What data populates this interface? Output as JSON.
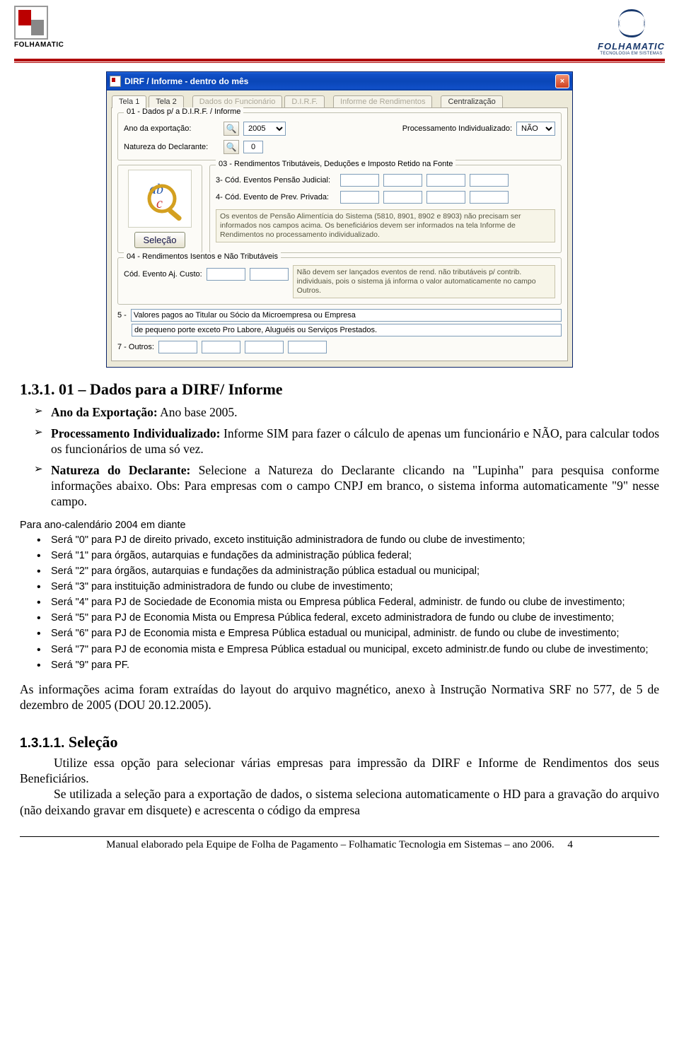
{
  "header": {
    "logo_left_label": "FOLHAMATIC",
    "logo_right_label": "FOLHAMATIC",
    "logo_right_sub": "TECNOLOGIA EM SISTEMAS"
  },
  "window": {
    "title": "DIRF / Informe - dentro do mês",
    "tabs": [
      "Tela 1",
      "Tela 2",
      "Dados do Funcionário",
      "D.I.R.F.",
      "Informe de Rendimentos",
      "Centralização"
    ],
    "section01": {
      "title": "01 - Dados p/ a D.I.R.F. / Informe",
      "ano_label": "Ano da exportação:",
      "ano_value": "2005",
      "proc_label": "Processamento Individualizado:",
      "proc_value": "NÃO",
      "nat_label": "Natureza do Declarante:",
      "nat_value": "0"
    },
    "selecao_btn": "Seleção",
    "section03": {
      "title": "03 - Rendimentos Tributáveis, Deduções e Imposto Retido na Fonte",
      "label3": "3- Cód. Eventos Pensão Judicial:",
      "label4": "4- Cód. Evento de Prev. Privada:",
      "note": "Os eventos de Pensão Alimentícia do Sistema (5810, 8901, 8902 e 8903) não precisam ser informados nos campos acima. Os beneficiários devem ser informados na tela Informe de Rendimentos no processamento individualizado."
    },
    "section04": {
      "title": "04 - Rendimentos Isentos e Não Tributáveis",
      "label": "Cód. Evento Aj. Custo:",
      "note": "Não devem ser lançados eventos de rend. não tributáveis p/ contrib. individuais, pois o sistema já informa o valor automaticamente no campo Outros."
    },
    "section05": {
      "label": "5 -",
      "text1": "Valores pagos ao Titular ou Sócio da Microempresa ou Empresa",
      "text2": "de pequeno porte exceto Pro Labore, Aluguéis ou Serviços Prestados."
    },
    "section07": {
      "label": "7 - Outros:"
    }
  },
  "doc": {
    "heading1": "1.3.1. 01 – Dados para a DIRF/ Informe",
    "bullets": [
      {
        "lead": "Ano da Exportação:",
        "rest": " Ano base 2005."
      },
      {
        "lead": "Processamento Individualizado:",
        "rest": " Informe SIM para fazer o cálculo de apenas um funcionário e NÃO, para calcular todos os funcionários de uma só vez."
      },
      {
        "lead": "Natureza do Declarante:",
        "rest": " Selecione a Natureza do Declarante clicando na \"Lupinha\" para pesquisa conforme informações abaixo. Obs: Para empresas com o campo CNPJ em branco, o sistema informa automaticamente \"9\" nesse campo."
      }
    ],
    "sub_intro": "Para ano-calendário 2004 em diante",
    "sub_bullets": [
      "Será \"0\" para PJ de direito privado, exceto instituição administradora de fundo ou clube de investimento;",
      "Será \"1\" para órgãos, autarquias e fundações da administração pública federal;",
      "Será \"2\" para órgãos, autarquias e fundações da administração pública estadual ou municipal;",
      "Será \"3\" para instituição administradora de fundo ou clube de investimento;",
      "Será \"4\" para PJ de Sociedade de Economia mista ou Empresa pública Federal, administr. de fundo ou clube de investimento;",
      "Será \"5\" para PJ de Economia Mista ou Empresa Pública federal, exceto administradora de fundo ou clube de investimento;",
      "Será \"6\" para PJ de Economia mista  e Empresa Pública estadual ou municipal, administr. de fundo ou clube de investimento;",
      "Será \"7\" para PJ de economia mista e Empresa Pública estadual ou municipal, exceto administr.de fundo ou clube de investimento;",
      "Será \"9\" para PF."
    ],
    "para1": "As informações acima foram extraídas do layout do arquivo magnético, anexo à Instrução Normativa SRF no 577, de 5 de dezembro de 2005 (DOU 20.12.2005).",
    "heading2_num": "1.3.1.1.",
    "heading2_text": " Seleção",
    "para2": "Utilize essa opção para selecionar várias empresas para impressão da DIRF e Informe de Rendimentos dos seus Beneficiários.",
    "para3": "Se utilizada a seleção para a exportação de dados, o sistema seleciona automaticamente o HD para a gravação do arquivo (não deixando gravar em disquete) e acrescenta o código da empresa"
  },
  "footer": {
    "text": "Manual elaborado pela Equipe de Folha de Pagamento – Folhamatic Tecnologia em Sistemas – ano 2006.",
    "page": "4"
  }
}
